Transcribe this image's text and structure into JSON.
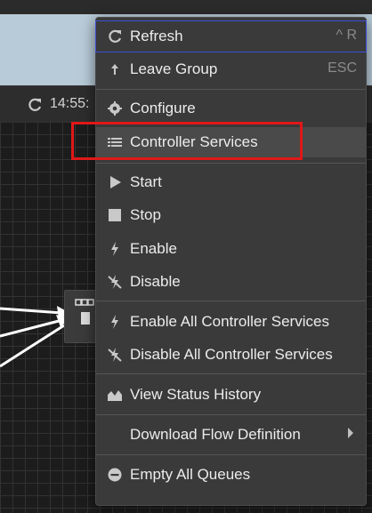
{
  "stats_bar": {
    "time": "14:55:"
  },
  "menu": {
    "items": [
      {
        "label": "Refresh",
        "icon": "refresh-icon",
        "shortcut": "^ R"
      },
      {
        "label": "Leave Group",
        "icon": "leave-group-icon",
        "shortcut": "ESC"
      },
      {
        "label": "Configure",
        "icon": "gear-icon"
      },
      {
        "label": "Controller Services",
        "icon": "list-icon"
      },
      {
        "label": "Start",
        "icon": "play-icon"
      },
      {
        "label": "Stop",
        "icon": "stop-icon"
      },
      {
        "label": "Enable",
        "icon": "bolt-icon"
      },
      {
        "label": "Disable",
        "icon": "bolt-off-icon"
      },
      {
        "label": "Enable All Controller Services",
        "icon": "bolt-icon"
      },
      {
        "label": "Disable All Controller Services",
        "icon": "bolt-off-icon"
      },
      {
        "label": "View Status History",
        "icon": "area-chart-icon"
      },
      {
        "label": "Download Flow Definition",
        "icon": ""
      },
      {
        "label": "Empty All Queues",
        "icon": "minus-circle-icon"
      }
    ]
  },
  "colors": {
    "highlight": "#e01818",
    "focus_outline": "#3d4fd6",
    "menu_bg": "#3a3a3a"
  }
}
